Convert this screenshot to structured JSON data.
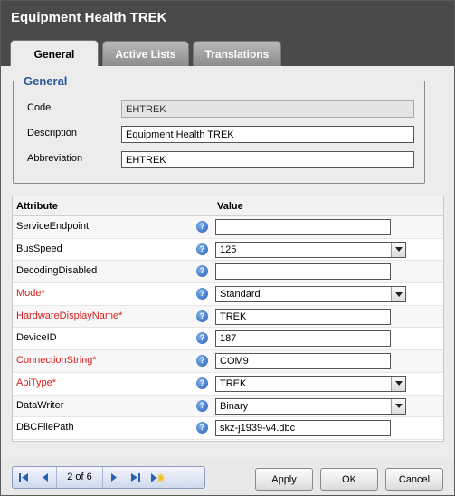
{
  "window": {
    "title": "Equipment Health TREK"
  },
  "tabs": [
    {
      "label": "General",
      "active": true
    },
    {
      "label": "Active Lists",
      "active": false
    },
    {
      "label": "Translations",
      "active": false
    }
  ],
  "general": {
    "legend": "General",
    "code_label": "Code",
    "code_value": "EHTREK",
    "description_label": "Description",
    "description_value": "Equipment Health TREK",
    "abbreviation_label": "Abbreviation",
    "abbreviation_value": "EHTREK"
  },
  "grid": {
    "columns": [
      "Attribute",
      "Value"
    ],
    "rows": [
      {
        "attribute": "ServiceEndpoint",
        "required": false,
        "type": "text",
        "value": ""
      },
      {
        "attribute": "BusSpeed",
        "required": false,
        "type": "select",
        "value": "125"
      },
      {
        "attribute": "DecodingDisabled",
        "required": false,
        "type": "text",
        "value": ""
      },
      {
        "attribute": "Mode*",
        "required": true,
        "type": "select",
        "value": "Standard"
      },
      {
        "attribute": "HardwareDisplayName*",
        "required": true,
        "type": "text",
        "value": "TREK"
      },
      {
        "attribute": "DeviceID",
        "required": false,
        "type": "text",
        "value": "187"
      },
      {
        "attribute": "ConnectionString*",
        "required": true,
        "type": "text",
        "value": "COM9"
      },
      {
        "attribute": "ApiType*",
        "required": true,
        "type": "select",
        "value": "TREK"
      },
      {
        "attribute": "DataWriter",
        "required": false,
        "type": "select",
        "value": "Binary"
      },
      {
        "attribute": "DBCFilePath",
        "required": false,
        "type": "text",
        "value": "skz-j1939-v4.dbc"
      }
    ],
    "help_glyph": "?"
  },
  "pager": {
    "text": "2 of 6"
  },
  "buttons": {
    "apply": "Apply",
    "ok": "OK",
    "cancel": "Cancel"
  },
  "icons": [
    "first-page-icon",
    "previous-page-icon",
    "next-page-icon",
    "last-page-icon",
    "new-record-icon",
    "help-icon",
    "dropdown-arrow-icon"
  ],
  "colors": {
    "titlebar": "#4a4a4a",
    "legend": "#2b5797",
    "required": "#d82020",
    "help": "#2a5fb8"
  }
}
